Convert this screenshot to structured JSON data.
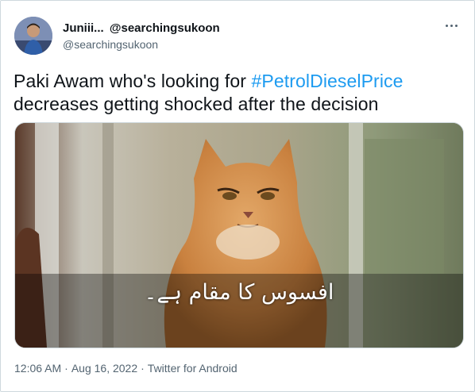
{
  "author": {
    "display_name": "Juniii...",
    "handle_inline": "@searchingsukoon",
    "handle": "@searchingsukoon"
  },
  "tweet": {
    "text_before": "Paki Awam who's looking for ",
    "hashtag": "#PetrolDieselPrice",
    "text_after": " decreases getting shocked after the decision"
  },
  "media": {
    "caption": "افسوس کا مقام ہے۔"
  },
  "meta": {
    "time": "12:06 AM",
    "separator": "·",
    "date": "Aug 16, 2022",
    "source": "Twitter for Android"
  },
  "colors": {
    "link": "#1d9bf0",
    "secondary_text": "#536471",
    "border": "#cfd9de"
  }
}
